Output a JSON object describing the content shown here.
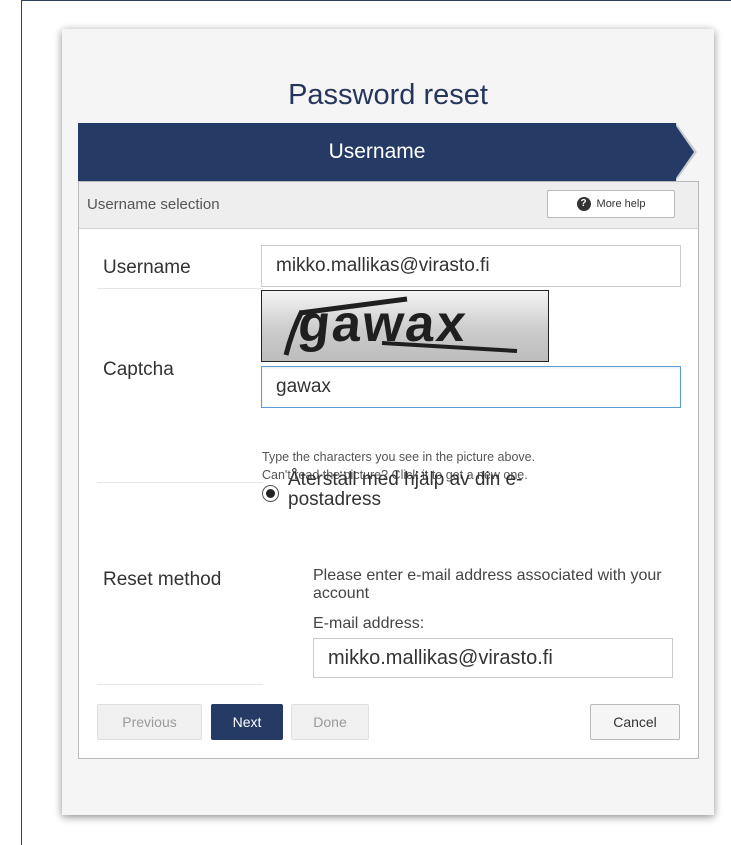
{
  "page": {
    "title": "Password reset"
  },
  "wizard": {
    "current_step": "Username"
  },
  "panel": {
    "heading": "Username selection",
    "help_button": "More help",
    "help_icon_glyph": "?"
  },
  "form": {
    "username": {
      "label": "Username",
      "value": "mikko.mallikas@virasto.fi"
    },
    "captcha": {
      "label": "Captcha",
      "image_text": "gawax",
      "value": "gawax",
      "hint_line1": "Type the characters you see in the picture above.",
      "hint_line2": "Can't read the picture? Click it to get a new one."
    },
    "reset_method": {
      "label": "Reset method",
      "option_label": "Återställ med hjälp av din e-postadress",
      "selected": true,
      "note": "Please enter e-mail address associated with your account",
      "email_label": "E-mail address:",
      "email_value": "mikko.mallikas@virasto.fi"
    }
  },
  "buttons": {
    "previous": "Previous",
    "next": "Next",
    "done": "Done",
    "cancel": "Cancel"
  },
  "colors": {
    "brand_navy": "#253b66",
    "title_blue": "#24365c",
    "input_focus": "#5b9bd5"
  },
  "icons": {
    "help": "question-circle-icon",
    "step_arrow": "chevron-right-shape"
  }
}
